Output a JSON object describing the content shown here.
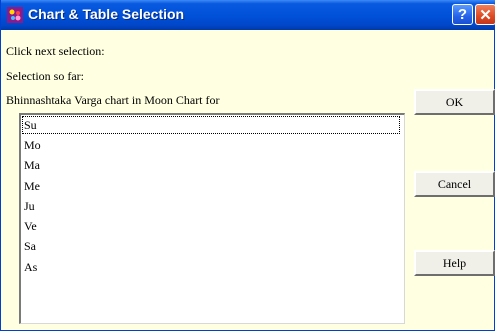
{
  "window": {
    "title": "Chart & Table Selection",
    "help_glyph": "?",
    "close_glyph": "✕"
  },
  "labels": {
    "instruction": "Click next selection:",
    "selection_so_far": "Selection so far:",
    "current_selection": "Bhinnashtaka Varga chart in Moon Chart  for"
  },
  "list": {
    "items": [
      "Su",
      "Mo",
      "Ma",
      "Me",
      "Ju",
      "Ve",
      "Sa",
      "As"
    ],
    "selected_index": 0
  },
  "buttons": {
    "ok": "OK",
    "cancel": "Cancel",
    "help": "Help"
  },
  "colors": {
    "titlebar": "#0050d8",
    "dialog_background": "#ffffe1",
    "close_button": "#dd4a22"
  }
}
